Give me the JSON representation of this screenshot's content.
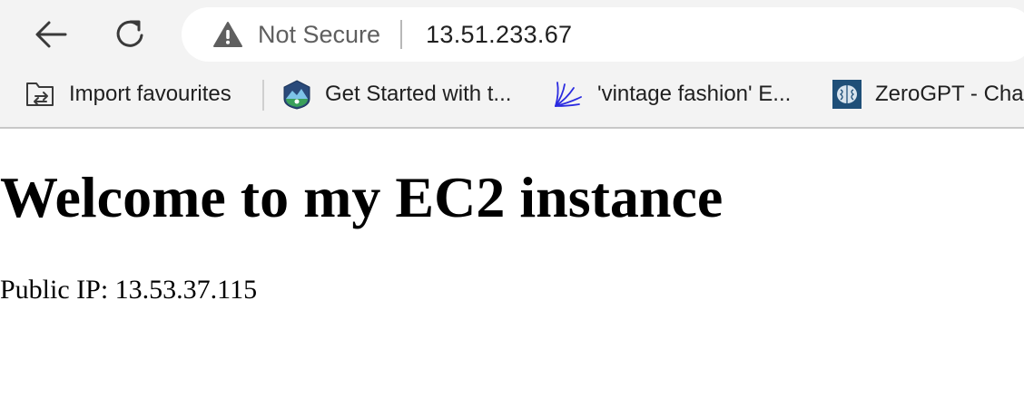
{
  "toolbar": {
    "security_label": "Not Secure",
    "url": "13.51.233.67"
  },
  "favorites": [
    {
      "label": "Import favourites",
      "icon": "folder-import-icon"
    },
    {
      "label": "Get Started with t...",
      "icon": "trailhead-icon"
    },
    {
      "label": "'vintage fashion' E...",
      "icon": "pinterest-brush-icon"
    },
    {
      "label": "ZeroGPT - Cha",
      "icon": "zerogpt-brain-icon"
    }
  ],
  "page": {
    "heading": "Welcome to my EC2 instance",
    "public_ip_text": "Public IP: 13.53.37.115"
  },
  "colors": {
    "chrome_bg": "#f3f3f3",
    "warning_gray": "#5f5f5f",
    "url_text": "#1f1f1f"
  }
}
